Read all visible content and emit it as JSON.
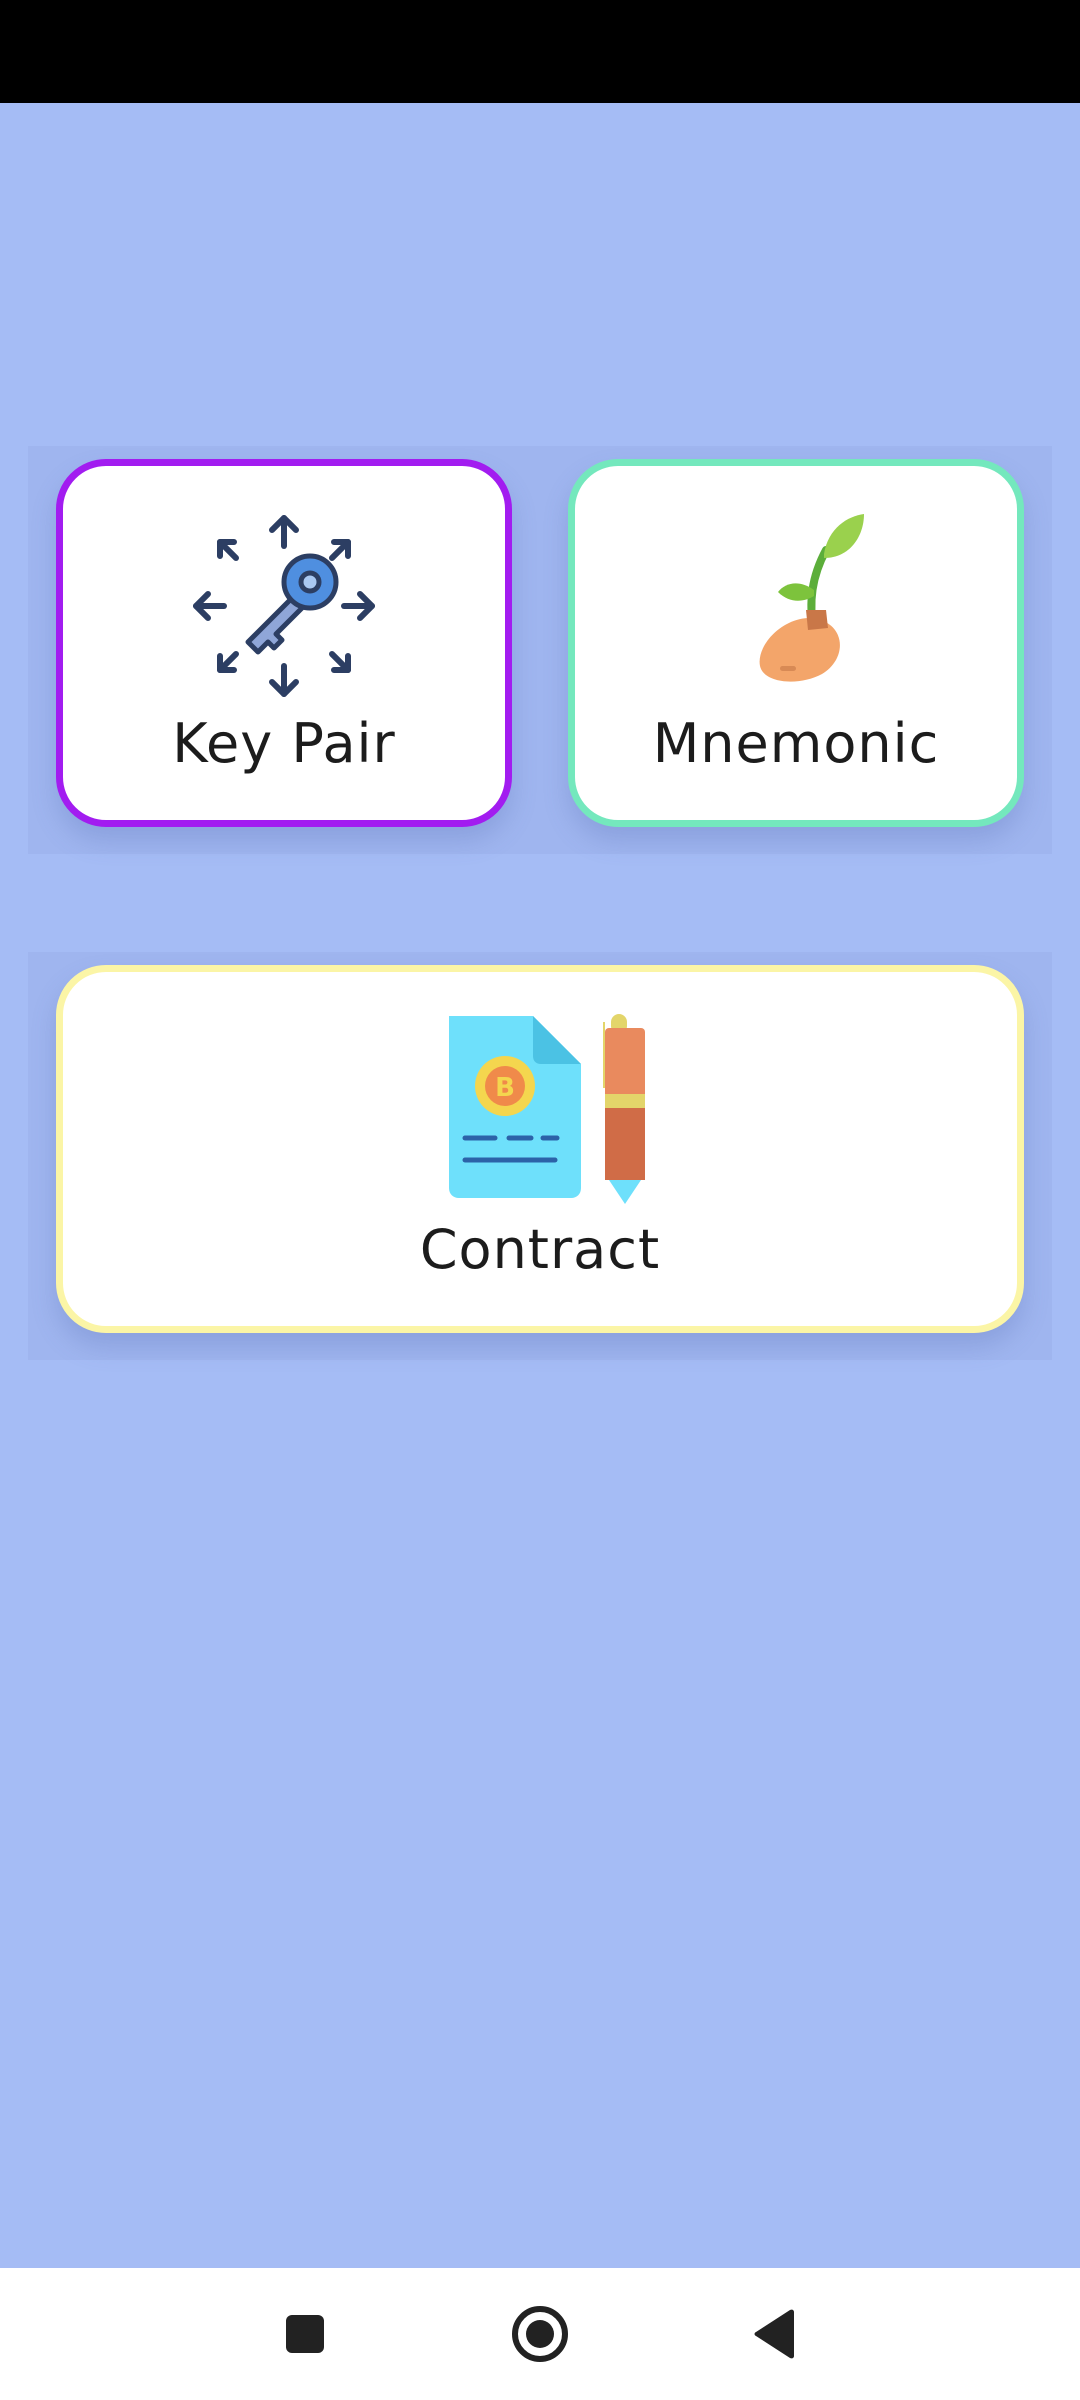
{
  "cards": {
    "key_pair": {
      "label": "Key Pair",
      "icon": "key-expand-icon",
      "border_color": "#a21cf0"
    },
    "mnemonic": {
      "label": "Mnemonic",
      "icon": "seed-sprout-icon",
      "border_color": "#74e8bd"
    },
    "contract": {
      "label": "Contract",
      "icon": "contract-pen-icon",
      "border_color": "#fbf5a6"
    }
  },
  "colors": {
    "background": "#a5bcf5",
    "card_background": "#ffffff",
    "text": "#1c1c1c",
    "status_bar": "#000000",
    "nav_bar": "#ffffff"
  },
  "nav": {
    "recents_icon": "square-icon",
    "home_icon": "circle-home-icon",
    "back_icon": "triangle-back-icon"
  }
}
